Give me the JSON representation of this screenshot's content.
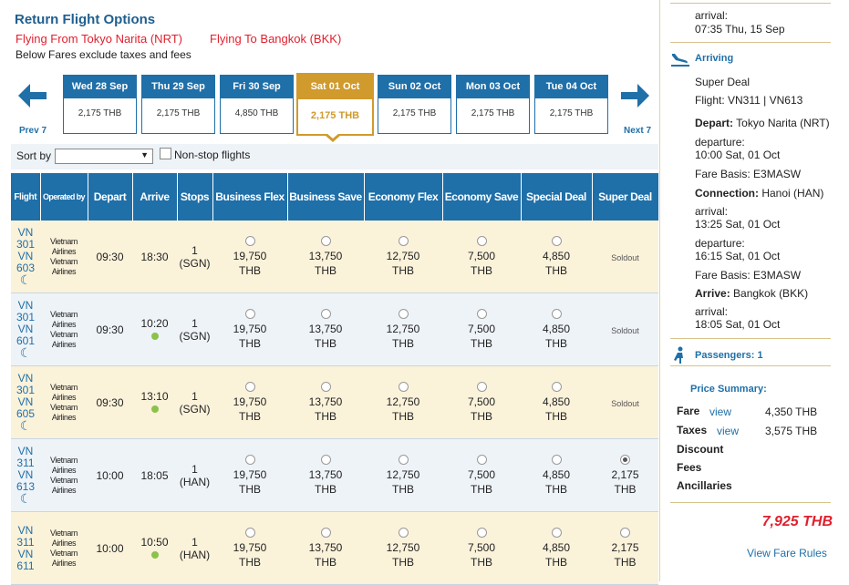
{
  "header": {
    "title": "Return Flight Options",
    "from_label": "Flying From Tokyo Narita (NRT)",
    "to_label": "Flying To Bangkok (BKK)",
    "note": "Below Fares exclude taxes and fees"
  },
  "date_nav": {
    "prev_label": "Prev 7",
    "next_label": "Next 7",
    "dates": [
      {
        "day": "Wed 28 Sep",
        "price": "2,175 THB"
      },
      {
        "day": "Thu 29 Sep",
        "price": "2,175 THB"
      },
      {
        "day": "Fri 30 Sep",
        "price": "4,850 THB"
      },
      {
        "day": "Sat 01 Oct",
        "price": "2,175 THB"
      },
      {
        "day": "Sun 02 Oct",
        "price": "2,175 THB"
      },
      {
        "day": "Mon 03 Oct",
        "price": "2,175 THB"
      },
      {
        "day": "Tue 04 Oct",
        "price": "2,175 THB"
      }
    ]
  },
  "sort": {
    "label": "Sort by",
    "value": "",
    "nonstop_label": "Non-stop flights"
  },
  "table": {
    "headers": [
      "Flight",
      "Operated by",
      "Depart",
      "Arrive",
      "Stops",
      "Business Flex",
      "Business Save",
      "Economy Flex",
      "Economy Save",
      "Special Deal",
      "Super Deal"
    ],
    "rows": [
      {
        "f1": "VN",
        "f2": "301",
        "f3": "VN",
        "f4": "603",
        "op1": "Vietnam",
        "op2": "Airlines",
        "op3": "Vietnam",
        "op4": "Airlines",
        "depart": "09:30",
        "arrive": "18:30",
        "stops1": "1",
        "stops2": "(SGN)",
        "p1a": "19,750",
        "p2a": "13,750",
        "p3a": "12,750",
        "p4a": "7,500",
        "p5a": "4,850",
        "p6": "Soldout",
        "cur": "THB"
      },
      {
        "f1": "VN",
        "f2": "301",
        "f3": "VN",
        "f4": "601",
        "op1": "Vietnam",
        "op2": "Airlines",
        "op3": "Vietnam",
        "op4": "Airlines",
        "depart": "09:30",
        "arrive": "10:20",
        "stops1": "1",
        "stops2": "(SGN)",
        "p1a": "19,750",
        "p2a": "13,750",
        "p3a": "12,750",
        "p4a": "7,500",
        "p5a": "4,850",
        "p6": "Soldout",
        "cur": "THB"
      },
      {
        "f1": "VN",
        "f2": "301",
        "f3": "VN",
        "f4": "605",
        "op1": "Vietnam",
        "op2": "Airlines",
        "op3": "Vietnam",
        "op4": "Airlines",
        "depart": "09:30",
        "arrive": "13:10",
        "stops1": "1",
        "stops2": "(SGN)",
        "p1a": "19,750",
        "p2a": "13,750",
        "p3a": "12,750",
        "p4a": "7,500",
        "p5a": "4,850",
        "p6": "Soldout",
        "cur": "THB"
      },
      {
        "f1": "VN",
        "f2": "311",
        "f3": "VN",
        "f4": "613",
        "op1": "Vietnam",
        "op2": "Airlines",
        "op3": "Vietnam",
        "op4": "Airlines",
        "depart": "10:00",
        "arrive": "18:05",
        "stops1": "1",
        "stops2": "(HAN)",
        "p1a": "19,750",
        "p2a": "13,750",
        "p3a": "12,750",
        "p4a": "7,500",
        "p5a": "4,850",
        "p6": "2,175",
        "cur": "THB"
      },
      {
        "f1": "VN",
        "f2": "311",
        "f3": "VN",
        "f4": "611",
        "op1": "Vietnam",
        "op2": "Airlines",
        "op3": "Vietnam",
        "op4": "Airlines",
        "depart": "10:00",
        "arrive": "10:50",
        "stops1": "1",
        "stops2": "(HAN)",
        "p1a": "19,750",
        "p2a": "13,750",
        "p3a": "12,750",
        "p4a": "7,500",
        "p5a": "4,850",
        "p6": "2,175",
        "cur": "THB"
      }
    ]
  },
  "summary": {
    "top_arrival_label": "arrival:",
    "top_arrival_time": "07:35 Thu, 15 Sep",
    "arriving_title": "Arriving",
    "fare_type": "Super Deal",
    "flight": "Flight: VN311 | VN613",
    "depart_label": "Depart:",
    "depart_place": "Tokyo Narita (NRT)",
    "departure_label": "departure:",
    "departure_time": "10:00 Sat, 01 Oct",
    "fare_basis_1": "Fare Basis: E3MASW",
    "connection_label": "Connection:",
    "connection_place": "Hanoi (HAN)",
    "conn_arrival_label": "arrival:",
    "conn_arrival_time": "13:25 Sat, 01 Oct",
    "conn_departure_label": "departure:",
    "conn_departure_time": "16:15 Sat, 01 Oct",
    "fare_basis_2": "Fare Basis: E3MASW",
    "arrive_label": "Arrive:",
    "arrive_place": "Bangkok (BKK)",
    "final_arrival_label": "arrival:",
    "final_arrival_time": "18:05 Sat, 01 Oct",
    "passengers": "Passengers: 1",
    "price_summary": "Price Summary:",
    "fare_label": "Fare",
    "fare_view": "view",
    "fare_value": "4,350 THB",
    "taxes_label": "Taxes",
    "taxes_view": "view",
    "taxes_value": "3,575 THB",
    "discount_label": "Discount",
    "fees_label": "Fees",
    "ancillaries_label": "Ancillaries",
    "total": "7,925 THB",
    "view_rules": "View Fare Rules"
  },
  "colors": {
    "brand_blue": "#1f6fa8",
    "gold": "#d09a2c",
    "red": "#e0202e",
    "row_yellow": "#fbf2da",
    "row_blue": "#eef3f8"
  }
}
